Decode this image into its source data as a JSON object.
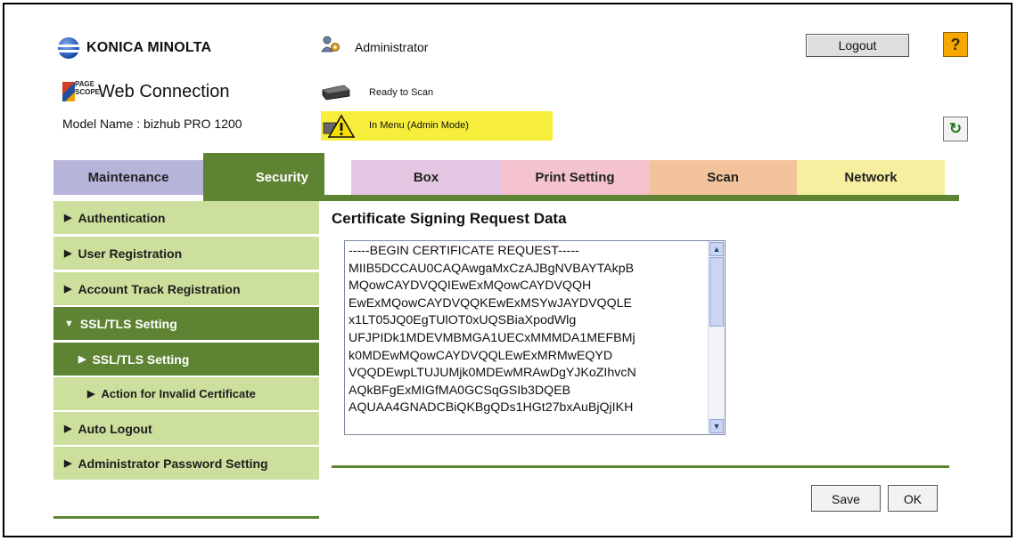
{
  "header": {
    "brand": "KONICA MINOLTA",
    "product_logo_text": "PAGE SCOPE",
    "product": "Web Connection",
    "model_label": "Model Name : bizhub PRO 1200",
    "user_role": "Administrator",
    "logout_label": "Logout",
    "help_label": "?",
    "status_ready": "Ready to Scan",
    "status_menu": "In Menu (Admin Mode)"
  },
  "tabs": [
    {
      "label": "Maintenance",
      "color": "#b7b4d9"
    },
    {
      "label": "Security",
      "color": "#5e8433",
      "selected": true
    },
    {
      "label": "Box",
      "color": "#e3c6e2"
    },
    {
      "label": "Print Setting",
      "color": "#f4c3cd"
    },
    {
      "label": "Scan",
      "color": "#f3c39b"
    },
    {
      "label": "Network",
      "color": "#f6ef9f"
    }
  ],
  "sidebar": {
    "items": [
      {
        "label": "Authentication"
      },
      {
        "label": "User Registration"
      },
      {
        "label": "Account Track Registration"
      },
      {
        "label": "SSL/TLS Setting",
        "expanded": true
      },
      {
        "label": "SSL/TLS Setting",
        "selected": true
      },
      {
        "label": "Action for Invalid Certificate"
      },
      {
        "label": "Auto Logout"
      },
      {
        "label": "Administrator Password Setting"
      }
    ]
  },
  "main": {
    "title": "Certificate Signing Request Data",
    "csr_text": "-----BEGIN CERTIFICATE REQUEST-----\nMIIB5DCCAU0CAQAwgaMxCzAJBgNVBAYTAkpB\nMQowCAYDVQQIEwExMQowCAYDVQQH\nEwExMQowCAYDVQQKEwExMSYwJAYDVQQLE\nx1LT05JQ0EgTUlOT0xUQSBiaXpodWlg\nUFJPIDk1MDEVMBMGA1UECxMMMDA1MEFBMj\nk0MDEwMQowCAYDVQQLEwExMRMwEQYD\nVQQDEwpLTUJUMjk0MDEwMRAwDgYJKoZIhvcN\nAQkBFgExMIGfMA0GCSqGSIb3DQEB\nAQUAA4GNADCBiQKBgQDs1HGt27bxAuBjQjIKH",
    "save_label": "Save",
    "ok_label": "OK"
  },
  "colors": {
    "accent_green": "#5e8433",
    "sidebar_green": "#ccdf9c",
    "status_yellow": "#f6ee3a",
    "help_orange": "#f7a800"
  },
  "icons": [
    "globe-logo-icon",
    "pagescope-logo-icon",
    "admin-user-icon",
    "scanner-icon",
    "warning-icon",
    "refresh-icon",
    "help-icon"
  ]
}
